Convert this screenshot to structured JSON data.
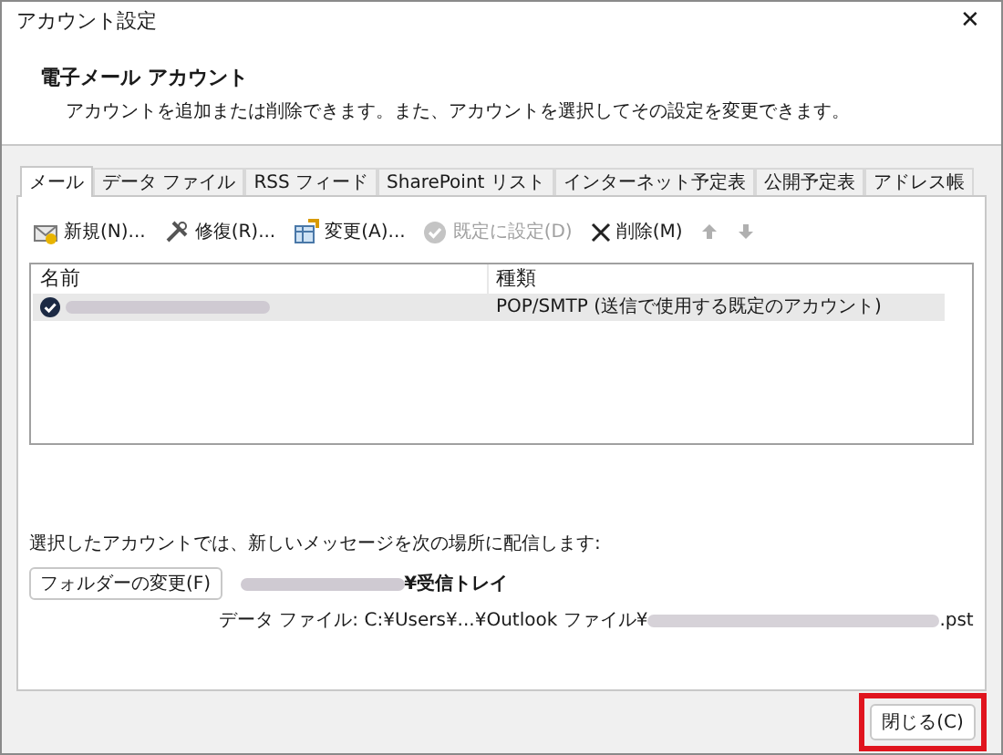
{
  "window": {
    "title": "アカウント設定",
    "close": "✕"
  },
  "header": {
    "title": "電子メール アカウント",
    "description": "アカウントを追加または削除できます。また、アカウントを選択してその設定を変更できます。"
  },
  "tabs": [
    {
      "label": "メール",
      "selected": true
    },
    {
      "label": "データ ファイル",
      "selected": false
    },
    {
      "label": "RSS フィード",
      "selected": false
    },
    {
      "label": "SharePoint リスト",
      "selected": false
    },
    {
      "label": "インターネット予定表",
      "selected": false
    },
    {
      "label": "公開予定表",
      "selected": false
    },
    {
      "label": "アドレス帳",
      "selected": false
    }
  ],
  "toolbar": [
    {
      "kind": "new",
      "label": "新規(N)...",
      "disabled": false
    },
    {
      "kind": "repair",
      "label": "修復(R)...",
      "disabled": false
    },
    {
      "kind": "change",
      "label": "変更(A)...",
      "disabled": false
    },
    {
      "kind": "default",
      "label": "既定に設定(D)",
      "disabled": true
    },
    {
      "kind": "delete",
      "label": "削除(M)",
      "disabled": false
    },
    {
      "kind": "up",
      "disabled": true
    },
    {
      "kind": "down",
      "disabled": true
    }
  ],
  "table": {
    "columns": [
      "名前",
      "種類"
    ],
    "rows": [
      {
        "default": true,
        "selected": true,
        "type": "POP/SMTP (送信で使用する既定のアカウント)"
      }
    ]
  },
  "delivery": {
    "text": "選択したアカウントでは、新しいメッセージを次の場所に配信します:",
    "button": "フォルダーの変更(F)",
    "folder_suffix": "¥受信トレイ",
    "data_file_prefix": "データ ファイル: C:¥Users¥...¥Outlook ファイル¥",
    "data_file_suffix": ".pst"
  },
  "footer": {
    "close_button": "閉じる(C)",
    "highlighted": true
  }
}
